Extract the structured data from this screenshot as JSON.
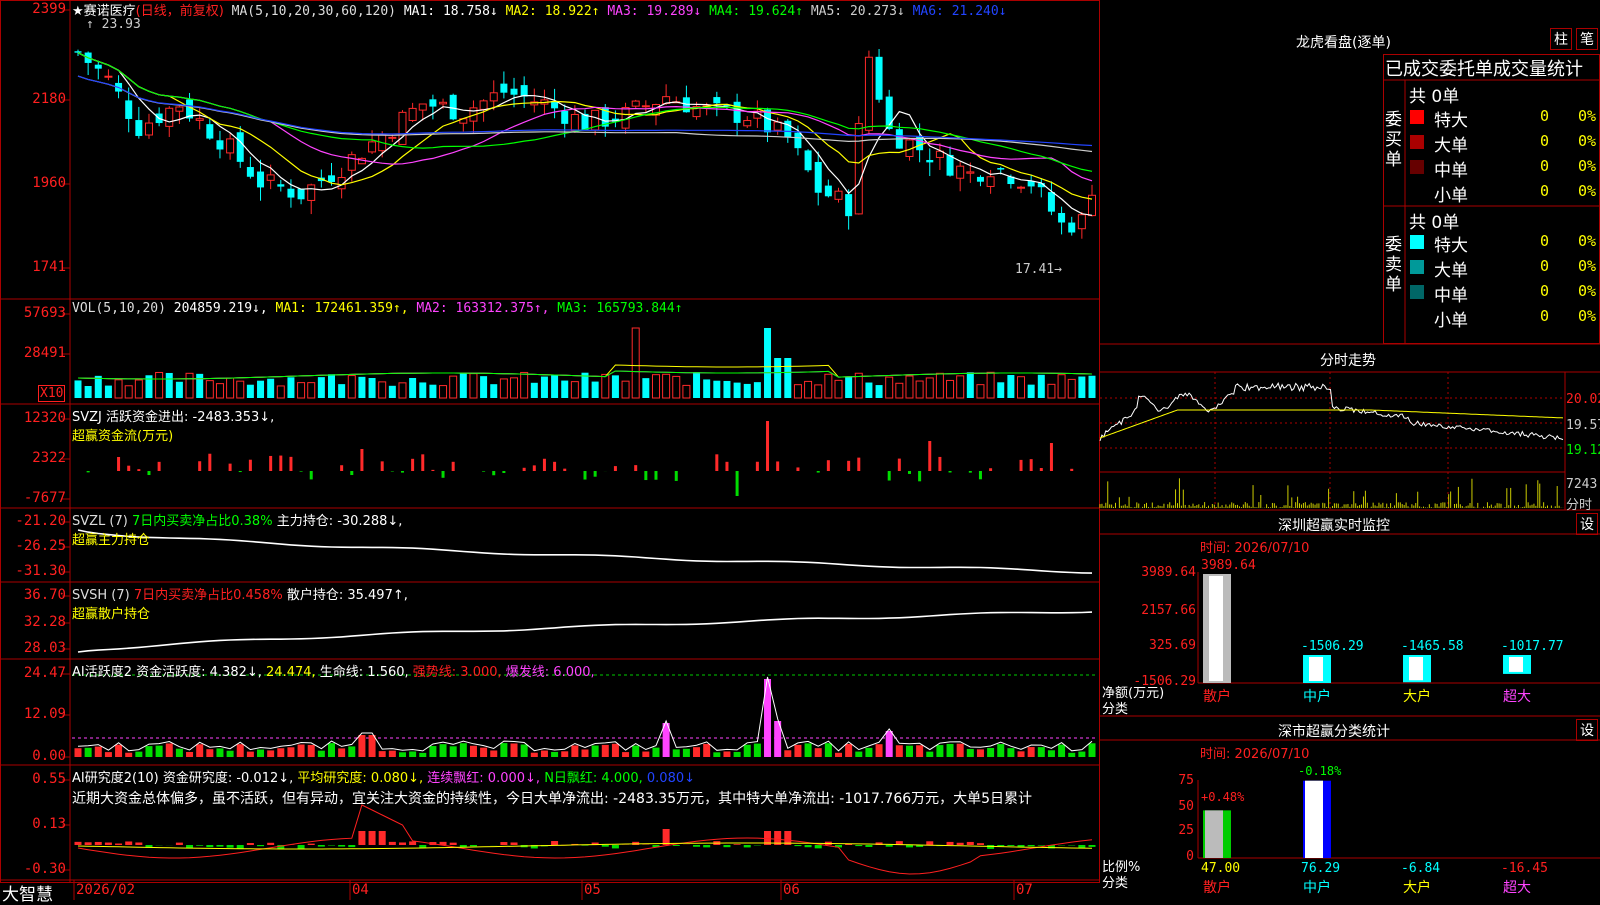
{
  "stock": {
    "title": "★赛诺医疗",
    "mode": "(日线，前复权)",
    "high_label": "23.93",
    "low_label": "17.41",
    "ma": [
      {
        "label": "MA(5,10,20,30,60,120)",
        "value": "",
        "color": "#dddddd"
      },
      {
        "label": "MA1:",
        "value": "18.758↓",
        "color": "#ffffff"
      },
      {
        "label": "MA2:",
        "value": "18.922↑",
        "color": "#ffff00"
      },
      {
        "label": "MA3:",
        "value": "19.289↓",
        "color": "#ff44ff"
      },
      {
        "label": "MA4:",
        "value": "19.624↑",
        "color": "#00ff00"
      },
      {
        "label": "MA5:",
        "value": "20.273↓",
        "color": "#cccccc"
      },
      {
        "label": "MA6:",
        "value": "21.240↓",
        "color": "#2244ff"
      }
    ],
    "price_axis": [
      "2399",
      "2180",
      "1960",
      "1741"
    ]
  },
  "vol": {
    "header": [
      {
        "text": "VOL(5,10,20)",
        "color": "#dddddd"
      },
      {
        "text": "204859.219↓,",
        "color": "#ffffff"
      },
      {
        "text": "MA1: 172461.359↑,",
        "color": "#ffff00"
      },
      {
        "text": "MA2: 163312.375↑,",
        "color": "#ff44ff"
      },
      {
        "text": "MA3: 165793.844↑",
        "color": "#00ff00"
      }
    ],
    "axis": [
      "57693",
      "28491"
    ],
    "unit": "X10"
  },
  "svzj": {
    "line1": "SVZJ  活跃资金进出: -2483.353↓,",
    "line2": "超赢资金流(万元)",
    "axis": [
      "12320",
      "2322",
      "-7677"
    ]
  },
  "svzl": {
    "parts": [
      {
        "text": "SVZL (7)",
        "color": "#dddddd"
      },
      {
        "text": "7日内买卖净占比0.38%",
        "color": "#00ff00"
      },
      {
        "text": "主力持仓: -30.288↓,",
        "color": "#ffffff"
      }
    ],
    "line2": "超赢主力持仓",
    "axis": [
      "-21.20",
      "-26.25",
      "-31.30"
    ]
  },
  "svsh": {
    "parts": [
      {
        "text": "SVSH (7)",
        "color": "#dddddd"
      },
      {
        "text": "7日内买卖净占比0.458%",
        "color": "#ff2020"
      },
      {
        "text": "散户持仓: 35.497↑,",
        "color": "#ffffff"
      }
    ],
    "line2": "超赢散户持仓",
    "axis": [
      "36.70",
      "32.28",
      "28.03"
    ]
  },
  "ai1": {
    "parts": [
      {
        "text": "AI活跃度2 资金活跃度: 4.382↓,",
        "color": "#ffffff"
      },
      {
        "text": "24.474,",
        "color": "#ffff00"
      },
      {
        "text": "生命线: 1.560,",
        "color": "#ffffff"
      },
      {
        "text": "强势线: 3.000,",
        "color": "#ff2020"
      },
      {
        "text": "爆发线: 6.000,",
        "color": "#ff44ff"
      }
    ],
    "axis": [
      "24.47",
      "12.09",
      "0.00"
    ]
  },
  "ai2": {
    "parts": [
      {
        "text": "AI研究度2(10) 资金研究度: -0.012↓,",
        "color": "#ffffff"
      },
      {
        "text": "平均研究度: 0.080↓,",
        "color": "#ffff00"
      },
      {
        "text": "连续飘红: 0.000↓,",
        "color": "#ff44ff"
      },
      {
        "text": "N日飘红: 4.000,",
        "color": "#00ff00"
      },
      {
        "text": "0.080↓",
        "color": "#2244ff"
      }
    ],
    "comment": "近期大资金总体偏多，虽不活跃，但有异动，宜关注大资金的持续性，今日大单净流出: -2483.35万元，其中特大单净流出: -1017.766万元，大单5日累计",
    "axis": [
      "0.55",
      "0.13",
      "-0.30"
    ]
  },
  "bottom": {
    "brand": "大智慧",
    "dates": [
      "2026/02",
      "04",
      "05",
      "06",
      "07"
    ]
  },
  "right": {
    "dragon": {
      "title": "龙虎看盘(逐单)",
      "btn_col": "柱",
      "btn_pen": "笔"
    },
    "tabs": [
      "已成交",
      "委托单",
      "成交量统计"
    ],
    "buy": {
      "side_label": "委买单",
      "total": "共 0单",
      "rows": [
        {
          "label": "特大",
          "count": "0",
          "pct": "0%",
          "color": "#ff0000"
        },
        {
          "label": "大单",
          "count": "0",
          "pct": "0%",
          "color": "#aa0000"
        },
        {
          "label": "中单",
          "count": "0",
          "pct": "0%",
          "color": "#660000"
        },
        {
          "label": "小单",
          "count": "0",
          "pct": "0%",
          "color": "#000000"
        }
      ]
    },
    "sell": {
      "side_label": "委卖单",
      "total": "共 0单",
      "rows": [
        {
          "label": "特大",
          "count": "0",
          "pct": "0%",
          "color": "#00ffff"
        },
        {
          "label": "大单",
          "count": "0",
          "pct": "0%",
          "color": "#009999"
        },
        {
          "label": "中单",
          "count": "0",
          "pct": "0%",
          "color": "#006666"
        },
        {
          "label": "小单",
          "count": "0",
          "pct": "0%",
          "color": "#000000"
        }
      ]
    },
    "intraday": {
      "title": "分时走势",
      "price_axis": [
        "20.02",
        "19.57",
        "19.12"
      ],
      "vol_axis": "7243",
      "vol_unit": "分时"
    },
    "monitor": {
      "title": "深圳超赢实时监控",
      "set_btn": "设",
      "time": "时间: 2026/07/10",
      "axis": [
        "3989.64",
        "2157.66",
        "325.69",
        "-1506.29"
      ],
      "y_title": "净额(万元)",
      "x_title": "分类",
      "categories": [
        "散户",
        "中户",
        "大户",
        "超大"
      ],
      "values": [
        "3989.64",
        "-1506.29",
        "-1465.58",
        "-1017.77"
      ]
    },
    "classify": {
      "title": "深市超赢分类统计",
      "set_btn": "设",
      "time": "时间: 2026/07/10",
      "axis": [
        "75",
        "50",
        "25",
        "0"
      ],
      "y_title": "比例%",
      "x_title": "分类",
      "categories": [
        "散户",
        "中户",
        "大户",
        "超大"
      ],
      "bar_labels": [
        "+0.48%",
        "-0.18%"
      ],
      "values": [
        "47.00",
        "76.29",
        "-6.84",
        "-16.45"
      ]
    }
  },
  "chart_data": {
    "type": "candlestick",
    "title": "★赛诺医疗",
    "ylim": [
      17.41,
      23.93
    ],
    "series": [
      {
        "name": "MA1",
        "values": [
          18.758
        ]
      },
      {
        "name": "MA2",
        "values": [
          18.922
        ]
      },
      {
        "name": "MA3",
        "values": [
          19.289
        ]
      },
      {
        "name": "MA4",
        "values": [
          19.624
        ]
      },
      {
        "name": "MA5",
        "values": [
          20.273
        ]
      },
      {
        "name": "MA6",
        "values": [
          21.24
        ]
      }
    ]
  },
  "colors": {
    "grid": "#aa0000",
    "up": "#ff2a2a",
    "down": "#00ffff",
    "green": "#00ee00",
    "yellow": "#ffff00",
    "magenta": "#ff44ff",
    "blue": "#2233ff"
  }
}
